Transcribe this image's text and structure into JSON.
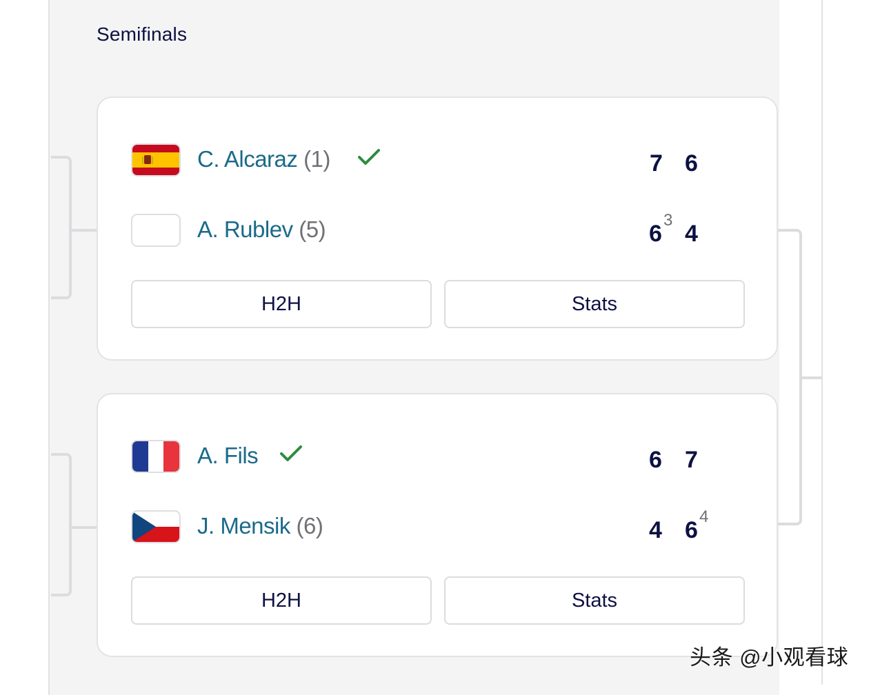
{
  "round": {
    "title": "Semifinals"
  },
  "matches": [
    {
      "players": [
        {
          "name": "C. Alcaraz",
          "seed": "(1)",
          "flag": "spain-flag",
          "winner": true,
          "sets": [
            "7",
            "6"
          ],
          "tiebreaks": [
            "",
            ""
          ]
        },
        {
          "name": "A. Rublev",
          "seed": "(5)",
          "flag": "blank-flag",
          "winner": false,
          "sets": [
            "6",
            "4"
          ],
          "tiebreaks": [
            "3",
            ""
          ]
        }
      ],
      "buttons": {
        "h2h": "H2H",
        "stats": "Stats"
      }
    },
    {
      "players": [
        {
          "name": "A. Fils",
          "seed": "",
          "flag": "france-flag",
          "winner": true,
          "sets": [
            "6",
            "7"
          ],
          "tiebreaks": [
            "",
            ""
          ]
        },
        {
          "name": "J. Mensik",
          "seed": "(6)",
          "flag": "czech-flag",
          "winner": false,
          "sets": [
            "4",
            "6"
          ],
          "tiebreaks": [
            "",
            "4"
          ]
        }
      ],
      "buttons": {
        "h2h": "H2H",
        "stats": "Stats"
      }
    }
  ],
  "colors": {
    "name": "#1b6a8a",
    "score": "#0d1142",
    "check": "#2e8b3e",
    "panel": "#f4f4f5"
  },
  "watermark": "头条 @小观看球"
}
